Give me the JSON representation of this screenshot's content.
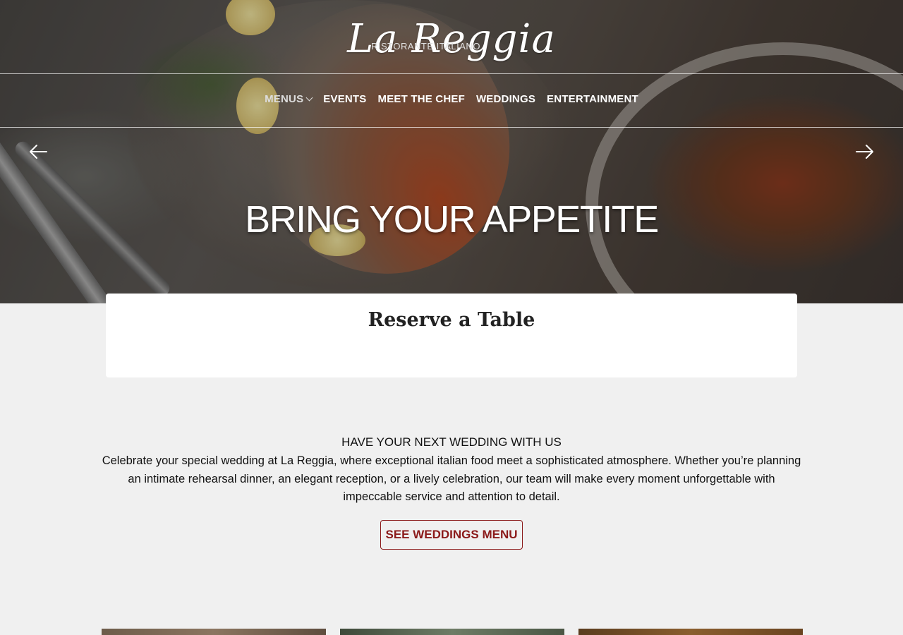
{
  "brand": {
    "name": "La Reggia",
    "tagline": "RISTORANTE ITALIANO"
  },
  "nav": {
    "items": [
      {
        "label": "MENUS",
        "has_dropdown": true
      },
      {
        "label": "EVENTS"
      },
      {
        "label": "MEET THE CHEF"
      },
      {
        "label": "WEDDINGS"
      },
      {
        "label": "ENTERTAINMENT"
      }
    ]
  },
  "hero": {
    "headline": "BRING YOUR APPETITE",
    "prev_icon": "arrow-left-icon",
    "next_icon": "arrow-right-icon"
  },
  "reserve": {
    "title": "Reserve a Table"
  },
  "weddings": {
    "heading": "HAVE YOUR NEXT WEDDING WITH US",
    "body": "Celebrate your special wedding at La Reggia, where exceptional italian food meet a sophisticated atmosphere. Whether you’re planning an intimate rehearsal dinner, an elegant reception, or a lively celebration, our team will make every moment unforgettable with impeccable service and attention to detail.",
    "button_label": "SEE WEDDINGS MENU"
  },
  "colors": {
    "accent": "#8b1a1a",
    "page_background": "#f0f0f0"
  }
}
